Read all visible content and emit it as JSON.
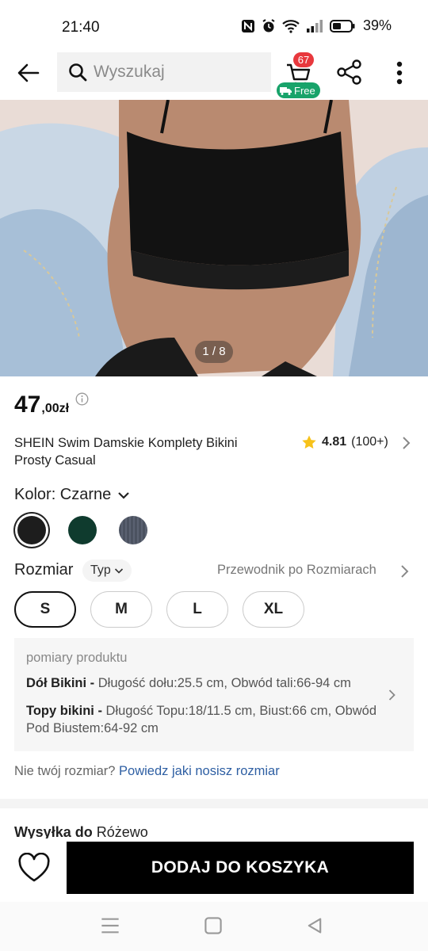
{
  "status_bar": {
    "time": "21:40",
    "battery": "39%"
  },
  "header": {
    "search_placeholder": "Wyszukaj",
    "cart_count": "67",
    "free_badge": "Free"
  },
  "gallery": {
    "counter": "1 / 8"
  },
  "product": {
    "price_main": "47",
    "price_sub": ",00zł",
    "title": "SHEIN Swim Damskie Komplety Bikini Prosty Casual",
    "rating": "4.81",
    "rating_count": "(100+)"
  },
  "color": {
    "label": "Kolor: Czarne",
    "swatches": [
      {
        "name": "Czarne",
        "hex": "#1d1d1d"
      },
      {
        "name": "green",
        "hex": "#0f3b2e"
      },
      {
        "name": "grey",
        "hex": "#4b5260"
      }
    ]
  },
  "size": {
    "label": "Rozmiar",
    "type_chip": "Typ",
    "guide_link": "Przewodnik po Rozmiarach",
    "options": [
      "S",
      "M",
      "L",
      "XL"
    ],
    "selected": "S"
  },
  "measurements": {
    "title": "pomiary produktu",
    "bottom_label": "Dół Bikini -",
    "bottom_text": " Długość dołu:25.5 cm, Obwód tali:66-94 cm",
    "top_label": "Topy bikini -",
    "top_text": " Długość Topu:18/11.5 cm, Biust:66 cm, Obwód Pod Biustem:64-92 cm"
  },
  "fit_prompt": {
    "question": "Nie twój rozmiar? ",
    "link": "Powiedz jaki nosisz rozmiar"
  },
  "shipping": {
    "label": "Wysyłka do",
    "destination": " Różewo"
  },
  "cta": {
    "add_to_cart": "DODAJ DO KOSZYKA"
  },
  "colors": {
    "accent": "#000000",
    "badge_red": "#e8383d",
    "free_green": "#18a36a",
    "link_blue": "#2e5fa3"
  }
}
